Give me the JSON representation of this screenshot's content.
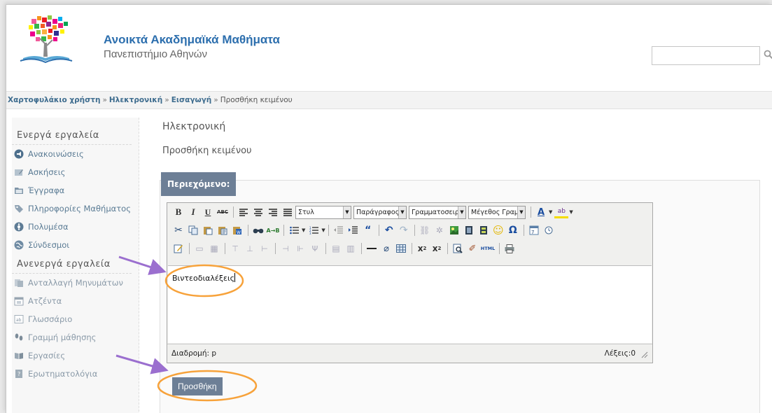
{
  "header": {
    "title": "Ανοικτά Ακαδημαϊκά Μαθήματα",
    "subtitle": "Πανεπιστήμιο Αθηνών",
    "search_placeholder": ""
  },
  "breadcrumb": [
    "Χαρτοφυλάκιο χρήστη",
    "Ηλεκτρονική",
    "Εισαγωγή",
    "Προσθήκη κειμένου"
  ],
  "sidebar": {
    "active_heading": "Ενεργά εργαλεία",
    "active_items": [
      {
        "label": "Ανακοινώσεις",
        "icon": "megaphone-icon"
      },
      {
        "label": "Ασκήσεις",
        "icon": "exercise-icon"
      },
      {
        "label": "Έγγραφα",
        "icon": "folder-icon"
      },
      {
        "label": "Πληροφορίες Μαθήματος",
        "icon": "tag-icon"
      },
      {
        "label": "Πολυμέσα",
        "icon": "multimedia-icon"
      },
      {
        "label": "Σύνδεσμοι",
        "icon": "globe-icon"
      }
    ],
    "inactive_heading": "Ανενεργά εργαλεία",
    "inactive_items": [
      {
        "label": "Ανταλλαγή Μηνυμάτων",
        "icon": "messages-icon"
      },
      {
        "label": "Ατζέντα",
        "icon": "calendar-icon"
      },
      {
        "label": "Γλωσσάριο",
        "icon": "glossary-icon"
      },
      {
        "label": "Γραμμή μάθησης",
        "icon": "footsteps-icon"
      },
      {
        "label": "Εργασίες",
        "icon": "book-icon"
      },
      {
        "label": "Ερωτηματολόγια",
        "icon": "questionnaire-icon"
      }
    ]
  },
  "main": {
    "title": "Ηλεκτρονική",
    "subtitle": "Προσθήκη κειμένου",
    "panel_label": "Περιεχόμενο:",
    "submit_label": "Προσθήκη"
  },
  "editor": {
    "style_select": "Στυλ",
    "format_select": "Παράγραφος",
    "font_select": "Γραμματοσειρά",
    "size_select": "Μέγεθος Γραμμ",
    "content": "Βιντεοδιαλέξεις",
    "path_label": "Διαδρομή: p",
    "word_count": "Λέξεις:0"
  },
  "colors": {
    "accent_blue": "#2d6fae",
    "button_bg": "#6d7f96",
    "annotation_orange": "#f7a23a",
    "annotation_purple": "#9b6fcf"
  }
}
